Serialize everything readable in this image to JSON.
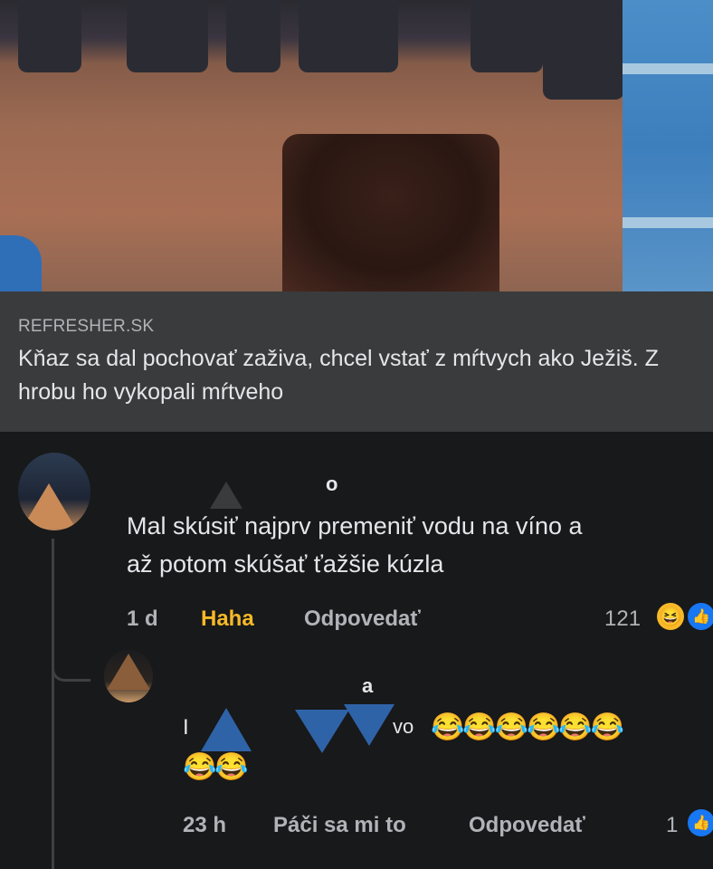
{
  "link_preview": {
    "source": "REFRESHER.SK",
    "title": "Kňaz sa dal pochovať zaživa, chcel vstať z mŕtvych ako Ježiš. Z hrobu ho vykopali mŕtveho"
  },
  "comment": {
    "text_line1": "Mal skúsiť najprv premeniť vodu na víno a",
    "text_line2": "až potom skúšať ťažšie kúzla",
    "time": "1 d",
    "reaction_label": "Haha",
    "reply_label": "Odpovedať",
    "reaction_count": "121",
    "name_fragment": "o"
  },
  "reply": {
    "name_fragment": "a",
    "text_fragment": "vo",
    "emojis_line1": "😂😂😂😂😂😂",
    "emojis_line2": "😂😂",
    "time": "23 h",
    "like_label": "Páči sa mi to",
    "reply_label": "Odpovedať",
    "reaction_count": "1",
    "text_prefix": "I"
  },
  "colors": {
    "background": "#18191a",
    "card": "#3a3b3c",
    "text_primary": "#e4e6eb",
    "text_secondary": "#b0b3b8",
    "haha": "#f7b928",
    "like_blue": "#1877f2"
  },
  "icons": {
    "haha_reaction": "laughing-face-icon",
    "like_reaction": "thumbs-up-icon"
  }
}
